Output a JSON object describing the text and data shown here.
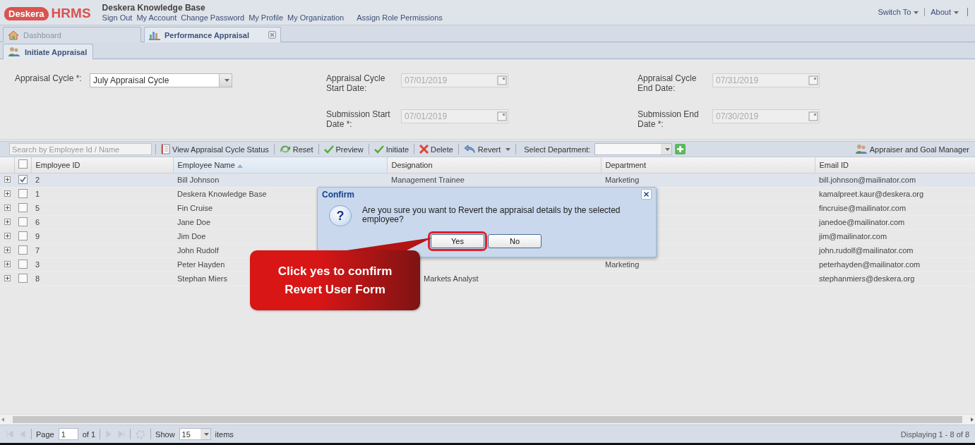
{
  "app": {
    "logo_brand": "Deskera",
    "logo_product": "HRMS",
    "title": "Deskera Knowledge Base",
    "links": [
      "Sign Out",
      "My Account",
      "Change Password",
      "My Profile",
      "My Organization",
      "Assign Role Permissions"
    ],
    "right_menus": [
      "Switch To",
      "About"
    ]
  },
  "tabs": [
    {
      "label": "Dashboard",
      "selected": false,
      "closable": false
    },
    {
      "label": "Performance Appraisal",
      "selected": true,
      "closable": true
    }
  ],
  "subtabs": [
    {
      "label": "Initiate Appraisal",
      "selected": true
    }
  ],
  "form": {
    "cycle": {
      "label": "Appraisal Cycle *:",
      "value": "July Appraisal Cycle"
    },
    "dates": [
      {
        "label": "Appraisal Cycle Start Date:",
        "value": "07/01/2019",
        "disabled": true
      },
      {
        "label": "Appraisal Cycle End Date:",
        "value": "07/31/2019",
        "disabled": true
      },
      {
        "label": "Submission Start Date *:",
        "value": "07/01/2019",
        "disabled": true
      },
      {
        "label": "Submission End Date *:",
        "value": "07/30/2019",
        "disabled": true
      }
    ]
  },
  "toolbar": {
    "search_placeholder": "Search by Employee Id / Name",
    "buttons": [
      {
        "label": "View Appraisal Cycle Status",
        "menu": false
      },
      {
        "label": "Reset",
        "menu": false
      },
      {
        "label": "Preview",
        "menu": false
      },
      {
        "label": "Initiate",
        "menu": false
      },
      {
        "label": "Delete",
        "menu": false
      },
      {
        "label": "Revert",
        "menu": true
      }
    ],
    "department_label": "Select Department:",
    "right_button": "Appraiser and Goal Manager"
  },
  "table": {
    "all_checked": false,
    "columns": [
      {
        "label": "Employee ID",
        "sorted": false
      },
      {
        "label": "Employee Name",
        "sorted": true
      },
      {
        "label": "Designation",
        "sorted": false
      },
      {
        "label": "Department",
        "sorted": false
      },
      {
        "label": "Email ID",
        "sorted": false
      }
    ],
    "rows": [
      {
        "selected": true,
        "cells": [
          "2",
          "Bill Johnson",
          "Management Trainee",
          "Marketing",
          "bill.johnson@mailinator.com"
        ]
      },
      {
        "selected": false,
        "cells": [
          "1",
          "Deskera Knowledge Base",
          "",
          "",
          "kamalpreet.kaur@deskera.org"
        ]
      },
      {
        "selected": false,
        "cells": [
          "5",
          "Fin Cruise",
          "",
          "",
          "fincruise@mailinator.com"
        ]
      },
      {
        "selected": false,
        "cells": [
          "6",
          "Jane Doe",
          "",
          "",
          "janedoe@mailinator.com"
        ]
      },
      {
        "selected": false,
        "cells": [
          "9",
          "Jim Doe",
          "",
          "",
          "jim@mailinator.com"
        ]
      },
      {
        "selected": false,
        "cells": [
          "7",
          "John Rudolf",
          "",
          "",
          "john.rudolf@mailinator.com"
        ]
      },
      {
        "selected": false,
        "cells": [
          "3",
          "Peter Hayden",
          "",
          "Marketing",
          "peterhayden@mailinator.com"
        ]
      },
      {
        "selected": false,
        "cut_designation": true,
        "cells": [
          "8",
          "Stephan Miers",
          "Markets Analyst",
          "",
          "stephanmiers@deskera.org"
        ]
      }
    ]
  },
  "pager": {
    "page_label": "Page",
    "page": "1",
    "of": "of 1",
    "show_label": "Show",
    "page_size": "15",
    "items_label": "items",
    "summary": "Displaying 1 - 8 of 8"
  },
  "dialog": {
    "title": "Confirm",
    "icon_glyph": "?",
    "message": "Are you sure you want to Revert the appraisal details by the selected employee?",
    "buttons": [
      {
        "label": "Yes",
        "highlighted": true
      },
      {
        "label": "No",
        "highlighted": false
      }
    ]
  },
  "callout": {
    "text": "Click yes to confirm Revert User Form"
  }
}
